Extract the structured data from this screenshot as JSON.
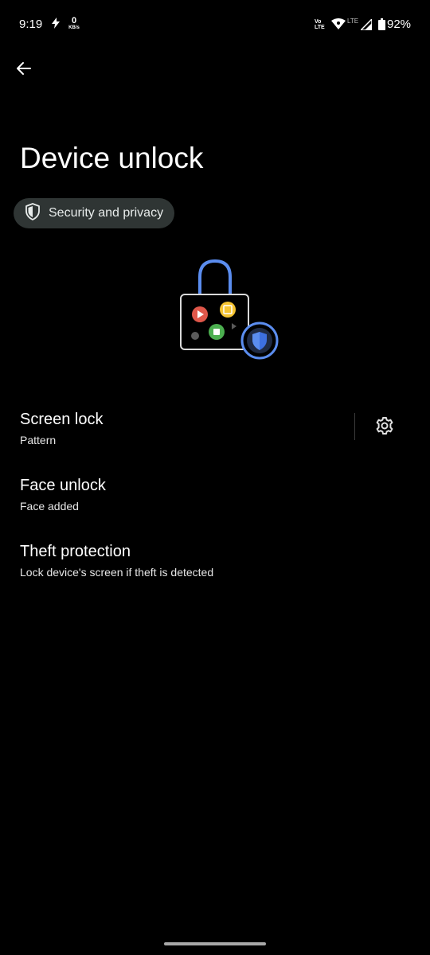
{
  "status_bar": {
    "time": "9:19",
    "data_speed_value": "0",
    "data_speed_unit": "KB/s",
    "volte_line1": "Vo",
    "volte_line2": "LTE",
    "lte_label": "LTE",
    "battery": "92%"
  },
  "page": {
    "title": "Device unlock",
    "breadcrumb": "Security and privacy"
  },
  "settings": [
    {
      "title": "Screen lock",
      "summary": "Pattern"
    },
    {
      "title": "Face unlock",
      "summary": "Face added"
    },
    {
      "title": "Theft protection",
      "summary": "Lock device's screen if theft is detected"
    }
  ],
  "icons": {
    "back": "arrow-back-icon",
    "breadcrumb": "shield-icon",
    "settings": "gear-icon"
  },
  "colors": {
    "background": "#000000",
    "chip_background": "#2f3534",
    "accent_blue": "#5b8def"
  }
}
